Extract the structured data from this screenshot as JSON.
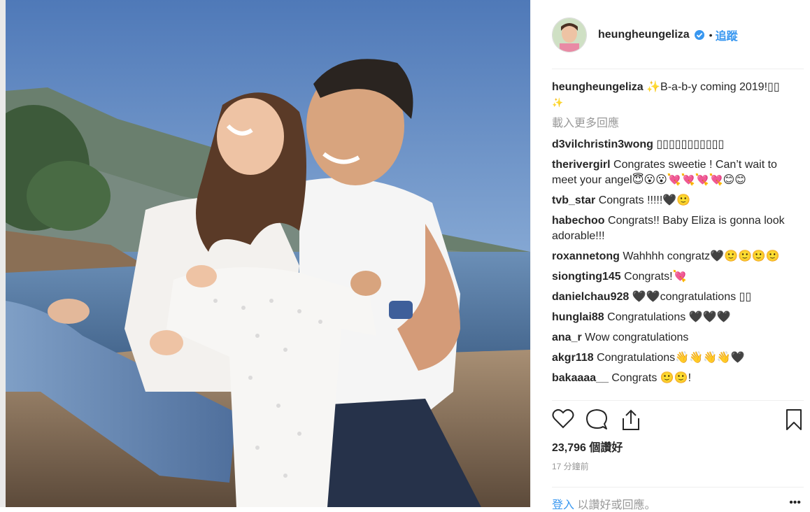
{
  "post": {
    "username": "heungheungeliza",
    "follow_label": "追蹤",
    "separator": "•",
    "caption_text": "✨B-a-b-y coming 2019!▯▯",
    "caption_sparkle": "✨",
    "load_more": "載入更多回應",
    "comments": [
      {
        "user": "d3vilchristin3wong",
        "text": "▯▯▯▯▯▯▯▯▯▯▯"
      },
      {
        "user": "therivergirl",
        "text": "Congrates sweetie ! Can’t wait to meet your angel😇😮😮💘💘💘💘😊😊"
      },
      {
        "user": "tvb_star",
        "text": "Congrats !!!!!🖤🙂"
      },
      {
        "user": "habechoo",
        "text": "Congrats!! Baby Eliza is gonna look adorable!!!"
      },
      {
        "user": "roxannetong",
        "text": "Wahhhh congratz🖤🙂🙂🙂🙂"
      },
      {
        "user": "siongting145",
        "text": "Congrats!💘"
      },
      {
        "user": "danielchau928",
        "text": "🖤🖤congratulations ▯▯"
      },
      {
        "user": "hunglai88",
        "text": "Congratulations 🖤🖤🖤"
      },
      {
        "user": "ana_r",
        "text": "Wow congratulations"
      },
      {
        "user": "akgr118",
        "text": "Congratulations👋👋👋👋🖤"
      },
      {
        "user": "bakaaaa__",
        "text": "Congrats 🙂🙂!"
      }
    ],
    "likes_label": "23,796 個讚好",
    "time_label": "17 分鐘前",
    "login_link": "登入",
    "login_text": "以讚好或回應。",
    "more_label": "•••",
    "icons": {
      "like": "heart-outline-icon",
      "comment": "comment-bubble-icon",
      "share": "share-upload-icon",
      "save": "bookmark-icon",
      "verified": "verified-badge-icon"
    },
    "colors": {
      "link": "#3897f0",
      "verified": "#3897f0",
      "muted": "#999999",
      "text": "#262626"
    }
  }
}
